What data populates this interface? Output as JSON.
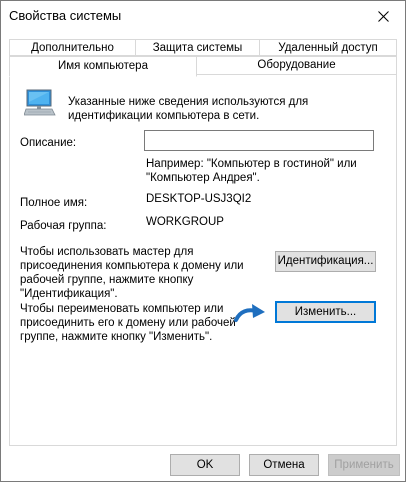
{
  "window": {
    "title": "Свойства системы"
  },
  "tabs_row1": [
    {
      "label": "Дополнительно"
    },
    {
      "label": "Защита системы"
    },
    {
      "label": "Удаленный доступ"
    }
  ],
  "tabs_row2": [
    {
      "label": "Имя компьютера",
      "active": true
    },
    {
      "label": "Оборудование",
      "active": false
    }
  ],
  "intro": {
    "line1": "Указанные ниже сведения используются для",
    "line2": "идентификации компьютера в сети."
  },
  "description": {
    "label": "Описание:",
    "value": "",
    "hint_line1": "Например: \"Компьютер в гостиной\" или",
    "hint_line2": "\"Компьютер Андрея\"."
  },
  "full_name": {
    "label": "Полное имя:",
    "value": "DESKTOP-USJ3QI2"
  },
  "workgroup": {
    "label": "Рабочая группа:",
    "value": "WORKGROUP"
  },
  "identification": {
    "line1": "Чтобы использовать мастер для",
    "line2": "присоединения компьютера к домену или",
    "line3": "рабочей группе, нажмите кнопку",
    "line4": "\"Идентификация\".",
    "button": "Идентификация..."
  },
  "rename": {
    "line1": "Чтобы переименовать компьютер или",
    "line2": "присоединить его к домену или рабочей",
    "line3": "группе, нажмите кнопку \"Изменить\".",
    "button": "Изменить..."
  },
  "footer": {
    "ok": "OK",
    "cancel": "Отмена",
    "apply": "Применить"
  },
  "colors": {
    "accent": "#0078d7",
    "arrow": "#1f6fbf"
  },
  "icons": [
    "close-icon",
    "computer-icon",
    "arrow-icon"
  ]
}
